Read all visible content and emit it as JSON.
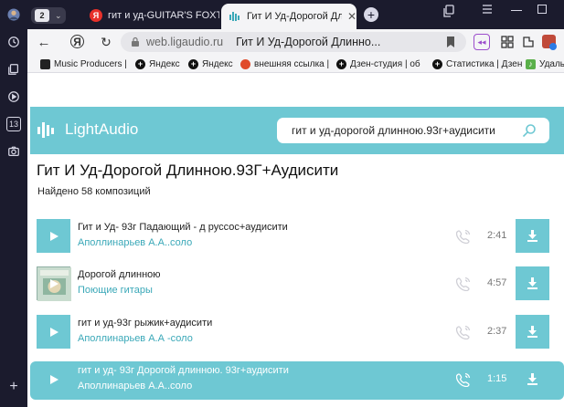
{
  "sidebar": {
    "icons": [
      "history-icon",
      "collections-icon",
      "video-icon",
      "badge-13-icon",
      "camera-icon",
      "plus-icon"
    ],
    "badge": "13"
  },
  "tabs": {
    "counter": "2",
    "items": [
      {
        "title": "гит и уд-GUITAR'S FOXTR",
        "favicon": "Я"
      },
      {
        "title": "Гит И Уд-Дорогой Длин",
        "favicon": "LA"
      }
    ]
  },
  "address": {
    "host": "web.ligaudio.ru",
    "page_title": "Гит И Уд-Дорогой Длинно..."
  },
  "bookmarks": [
    {
      "label": "Music Producers |"
    },
    {
      "label": "Яндекс"
    },
    {
      "label": "Яндекс"
    },
    {
      "label": "внешняя ссылка |"
    },
    {
      "label": "Дзен-студия | об"
    },
    {
      "label": "Статистика | Дзен"
    },
    {
      "label": "Удаль"
    }
  ],
  "site": {
    "logo_text": "LightAudio",
    "search_value": "гит и уд-дорогой длинною.93г+аудисити",
    "heading": "Гит И Уд-Дорогой Длинною.93Г+Аудисити",
    "found_text": "Найдено 58 композиций"
  },
  "tracks": [
    {
      "title": "Гит и Уд- 93г Падающий - д руссос+аудисити",
      "artist": "Аполлинарьев А.А..соло",
      "duration": "2:41",
      "has_cover_image": false,
      "active": false
    },
    {
      "title": "Дорогой длинною",
      "artist": "Поющие гитары",
      "duration": "4:57",
      "has_cover_image": true,
      "active": false
    },
    {
      "title": "гит и уд-93г рыжик+аудисити",
      "artist": "Аполлинарьев А.А -соло",
      "duration": "2:37",
      "has_cover_image": false,
      "active": false
    },
    {
      "title": "гит и уд- 93г Дорогой длинною. 93г+аудисити",
      "artist": "Аполлинарьев А.А..соло",
      "duration": "1:15",
      "has_cover_image": false,
      "active": true
    }
  ],
  "colors": {
    "accent": "#6ec8d3",
    "artist_link": "#3aa8b8",
    "browser_chrome": "#1b1b2d"
  }
}
